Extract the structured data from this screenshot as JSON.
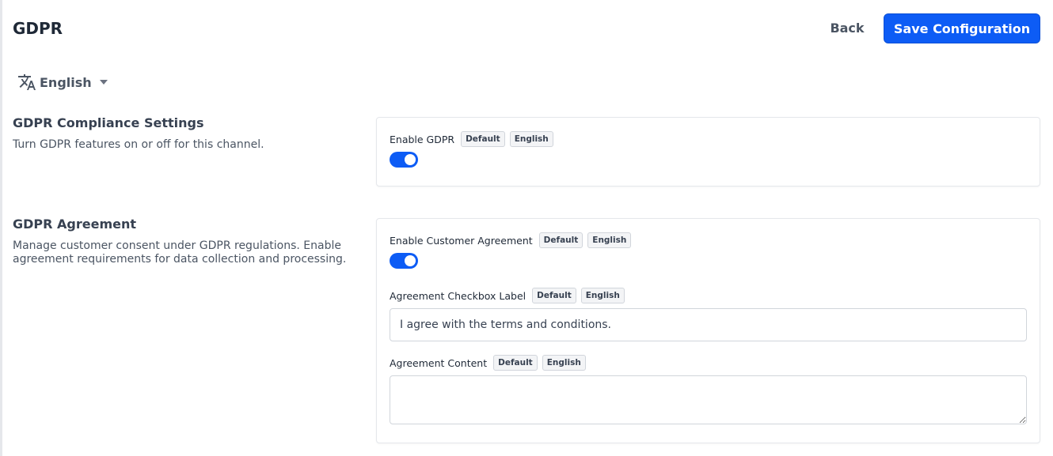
{
  "header": {
    "title": "GDPR",
    "back_label": "Back",
    "save_label": "Save Configuration"
  },
  "locale": {
    "icon": "translate-icon",
    "selected": "English"
  },
  "sections": {
    "compliance": {
      "title": "GDPR Compliance Settings",
      "description": "Turn GDPR features on or off for this channel.",
      "enable_gdpr": {
        "label": "Enable GDPR",
        "badge_default": "Default",
        "badge_locale": "English",
        "enabled": true
      }
    },
    "agreement": {
      "title": "GDPR Agreement",
      "description": "Manage customer consent under GDPR regulations. Enable agreement requirements for data collection and processing.",
      "enable_customer_agreement": {
        "label": "Enable Customer Agreement",
        "badge_default": "Default",
        "badge_locale": "English",
        "enabled": true
      },
      "checkbox_label": {
        "label": "Agreement Checkbox Label",
        "badge_default": "Default",
        "badge_locale": "English",
        "value": "I agree with the terms and conditions."
      },
      "content": {
        "label": "Agreement Content",
        "badge_default": "Default",
        "badge_locale": "English",
        "value": ""
      }
    }
  },
  "colors": {
    "primary": "#0d5cf5",
    "text": "#1f2937",
    "muted": "#4b5563",
    "border": "#e5e7eb"
  }
}
